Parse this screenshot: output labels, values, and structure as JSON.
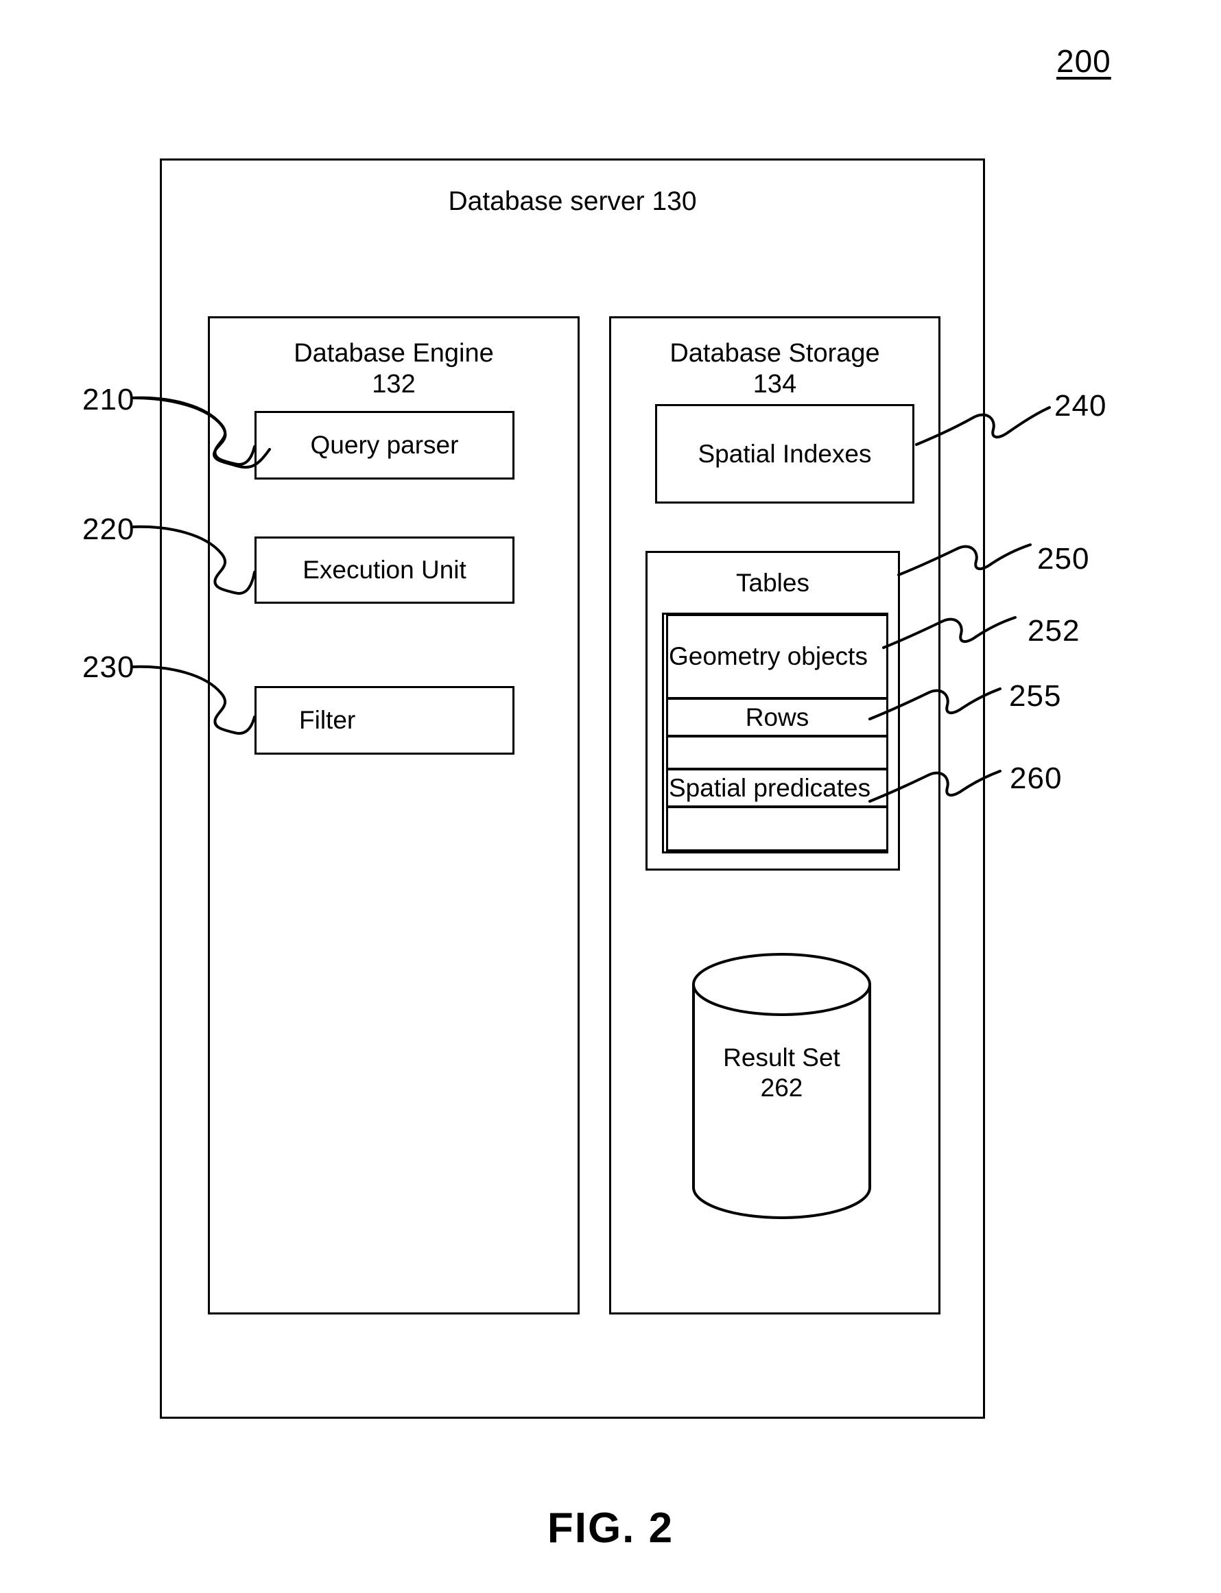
{
  "figure": {
    "reference_number": "200",
    "caption": "FIG. 2"
  },
  "server": {
    "title": "Database server 130"
  },
  "engine_panel": {
    "title": "Database Engine\n132",
    "components": [
      {
        "label": "Query parser",
        "ref": "210"
      },
      {
        "label": "Execution Unit",
        "ref": "220"
      },
      {
        "label": "Filter",
        "ref": "230"
      }
    ]
  },
  "storage_panel": {
    "title": "Database Storage\n134",
    "spatial_indexes": {
      "label": "Spatial Indexes",
      "ref": "240"
    },
    "tables": {
      "label": "Tables",
      "ref": "250",
      "bands": [
        {
          "label": "Geometry objects",
          "ref": "252"
        },
        {
          "label": "Rows",
          "ref": "255"
        },
        {
          "label": "",
          "ref": ""
        },
        {
          "label": "Spatial predicates",
          "ref": "260"
        },
        {
          "label": "",
          "ref": ""
        }
      ]
    },
    "result_set": {
      "label": "Result Set\n262"
    }
  },
  "reference_numerals": {
    "r210": "210",
    "r220": "220",
    "r230": "230",
    "r240": "240",
    "r250": "250",
    "r252": "252",
    "r255": "255",
    "r260": "260"
  },
  "colors": {
    "stroke": "#000000",
    "background": "#ffffff"
  }
}
